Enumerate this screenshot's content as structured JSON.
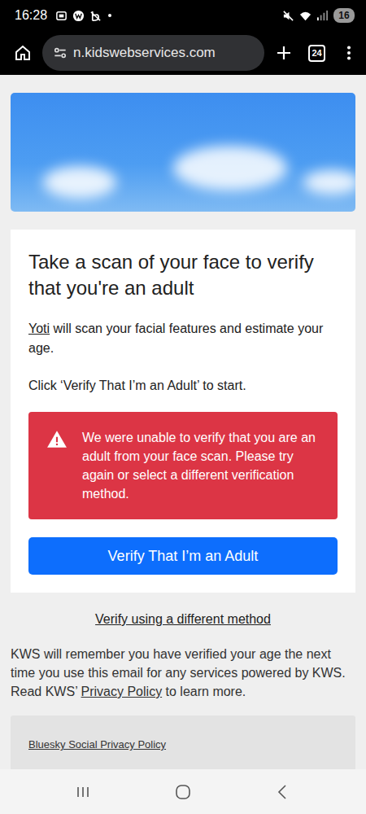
{
  "status_bar": {
    "time": "16:28",
    "battery": "16"
  },
  "browser": {
    "url": "n.kidswebservices.com",
    "tab_count": "24"
  },
  "card": {
    "title": "Take a scan of your face to verify that you're an adult",
    "intro_link": "Yoti",
    "intro_rest": " will scan your facial features and estimate your age.",
    "instruction": "Click ‘Verify That I’m an Adult’ to start.",
    "error": "We were unable to verify that you are an adult from your face scan. Please try again or select a different verification method.",
    "button": "Verify That I’m an Adult"
  },
  "alternate_link": "Verify using a different method",
  "notice": {
    "before": "KWS will remember you have verified your age the next time you use this email for any services powered by KWS. Read KWS’ ",
    "link": "Privacy Policy",
    "after": " to learn more."
  },
  "footer_link": "Bluesky Social Privacy Policy"
}
